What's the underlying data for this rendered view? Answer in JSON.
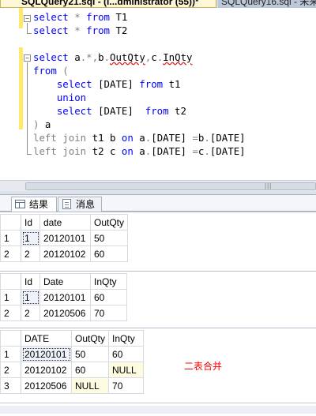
{
  "tabs": {
    "active": "SQLQuery21.sql - (l...dministrator (55))*",
    "inactive": "SQLQuery16.sql - 未来"
  },
  "editor": {
    "lines": [
      [
        {
          "t": "kw",
          "v": "select"
        },
        {
          "t": "gr",
          "v": " * "
        },
        {
          "t": "kw",
          "v": "from"
        },
        {
          "t": "tx",
          "v": " T1"
        }
      ],
      [
        {
          "t": "kw",
          "v": "select"
        },
        {
          "t": "gr",
          "v": " * "
        },
        {
          "t": "kw",
          "v": "from"
        },
        {
          "t": "tx",
          "v": " T2"
        }
      ],
      [],
      [
        {
          "t": "kw",
          "v": "select"
        },
        {
          "t": "tx",
          "v": " a"
        },
        {
          "t": "gr",
          "v": ".*,"
        },
        {
          "t": "tx",
          "v": "b"
        },
        {
          "t": "gr",
          "v": "."
        },
        {
          "t": "sq",
          "v": "OutQty"
        },
        {
          "t": "gr",
          "v": ","
        },
        {
          "t": "tx",
          "v": "c"
        },
        {
          "t": "gr",
          "v": "."
        },
        {
          "t": "sq",
          "v": "InQty"
        }
      ],
      [
        {
          "t": "kw",
          "v": "from"
        },
        {
          "t": "gr",
          "v": " ("
        }
      ],
      [
        {
          "t": "tx",
          "v": "    "
        },
        {
          "t": "kw",
          "v": "select"
        },
        {
          "t": "tx",
          "v": " [DATE] "
        },
        {
          "t": "kw",
          "v": "from"
        },
        {
          "t": "tx",
          "v": " t1"
        }
      ],
      [
        {
          "t": "tx",
          "v": "    "
        },
        {
          "t": "kw",
          "v": "union"
        }
      ],
      [
        {
          "t": "tx",
          "v": "    "
        },
        {
          "t": "kw",
          "v": "select"
        },
        {
          "t": "tx",
          "v": " [DATE]  "
        },
        {
          "t": "kw",
          "v": "from"
        },
        {
          "t": "tx",
          "v": " t2"
        }
      ],
      [
        {
          "t": "gr",
          "v": ") "
        },
        {
          "t": "tx",
          "v": "a"
        }
      ],
      [
        {
          "t": "gr",
          "v": "left join "
        },
        {
          "t": "tx",
          "v": "t1 b "
        },
        {
          "t": "kw",
          "v": "on"
        },
        {
          "t": "tx",
          "v": " a"
        },
        {
          "t": "gr",
          "v": "."
        },
        {
          "t": "tx",
          "v": "[DATE] "
        },
        {
          "t": "gr",
          "v": "="
        },
        {
          "t": "tx",
          "v": "b"
        },
        {
          "t": "gr",
          "v": "."
        },
        {
          "t": "tx",
          "v": "[DATE]"
        }
      ],
      [
        {
          "t": "gr",
          "v": "left join "
        },
        {
          "t": "tx",
          "v": "t2 c "
        },
        {
          "t": "kw",
          "v": "on"
        },
        {
          "t": "tx",
          "v": " a"
        },
        {
          "t": "gr",
          "v": "."
        },
        {
          "t": "tx",
          "v": "[DATE] "
        },
        {
          "t": "gr",
          "v": "="
        },
        {
          "t": "tx",
          "v": "c"
        },
        {
          "t": "gr",
          "v": "."
        },
        {
          "t": "tx",
          "v": "[DATE]"
        }
      ]
    ],
    "fold_glyph": "−"
  },
  "scroll_grip": "|||",
  "result_tabs": {
    "results": "结果",
    "messages": "消息"
  },
  "grids": [
    {
      "columns": [
        "Id",
        "date",
        "OutQty"
      ],
      "rows": [
        [
          "1",
          "20120101",
          "50"
        ],
        [
          "2",
          "20120102",
          "60"
        ]
      ]
    },
    {
      "columns": [
        "Id",
        "Date",
        "InQty"
      ],
      "rows": [
        [
          "1",
          "20120101",
          "60"
        ],
        [
          "2",
          "20120506",
          "70"
        ]
      ]
    },
    {
      "columns": [
        "DATE",
        "OutQty",
        "InQty"
      ],
      "rows": [
        [
          "20120101",
          "50",
          "60"
        ],
        [
          "20120102",
          "60",
          "NULL"
        ],
        [
          "20120506",
          "NULL",
          "70"
        ]
      ]
    }
  ],
  "note": "二表合并"
}
